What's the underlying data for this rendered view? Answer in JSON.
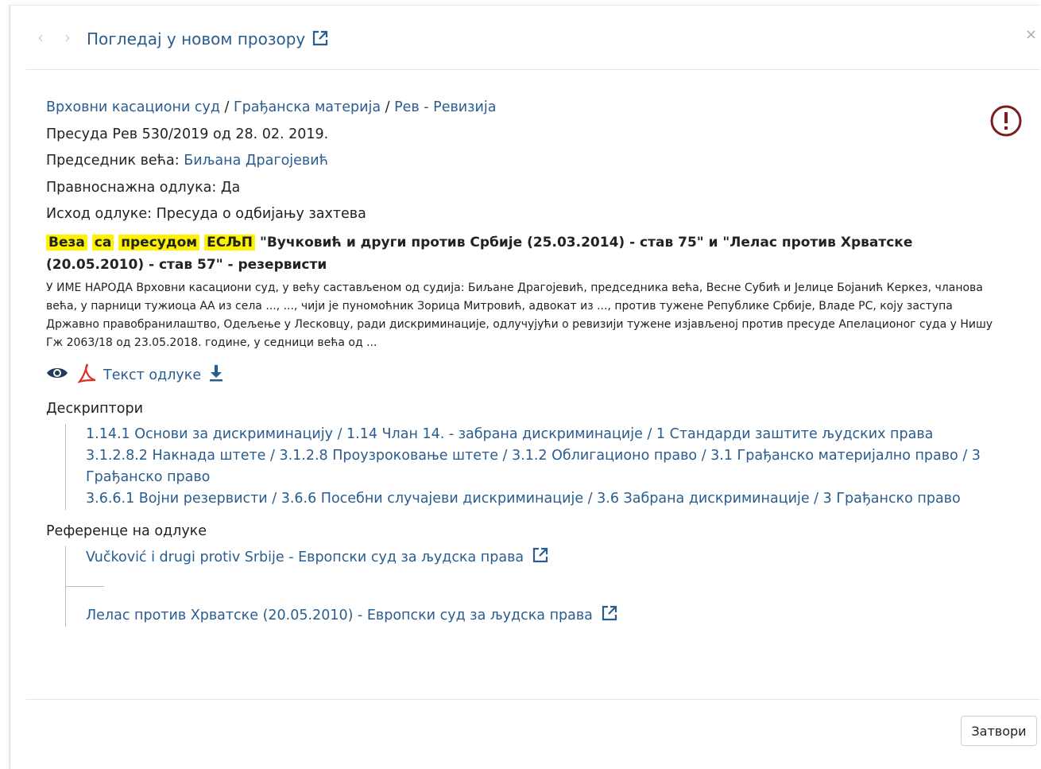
{
  "header": {
    "prev_icon": "chevron-left-icon",
    "next_icon": "chevron-right-icon",
    "open_new_window": "Погледај у новом прозору",
    "close_symbol": "×"
  },
  "breadcrumb": {
    "court": "Врховни касациони суд",
    "matter": "Грађанска материја",
    "type": "Рев - Ревизија",
    "separator": " / "
  },
  "case": {
    "title": "Пресуда Рев 530/2019 од 28. 02. 2019.",
    "president_label": "Председник већа: ",
    "president_name": "Биљана Драгојевић",
    "final_label": "Правноснажна одлука: Да",
    "outcome_label": "Исход одлуке: Пресуда о одбијању захтева"
  },
  "relation": {
    "tags": [
      "Веза",
      "са",
      "пресудом",
      "ЕСЉП"
    ],
    "text": "\"Вучковић и други против Србије (25.03.2014) - став 75\" и \"Лелас против Хрватске (20.05.2010) - став 57\" - резервисти"
  },
  "summary": "У ИМЕ НАРОДА Врховни касациони суд, у већу састављеном од судија: Биљане Драгојевић, председника већа, Весне Субић и Јелице Бојанић Керкез, чланова већа, у парници тужиоца АА из села ..., ..., чији је пуномоћник Зорица Митровић, адвокат из ..., против тужене Републике Србије, Владе РС, коју заступа Државно правобранилаштво, Одељење у Лесковцу, ради дискриминације, одлучујући о ревизији тужене изјављеној против пресуде Апелационог суда у Нишу Гж 2063/18 од 23.05.2018. године, у седници већа од ...",
  "document": {
    "label": "Текст одлуке"
  },
  "descriptors": {
    "title": "Дескриптори",
    "items": [
      "1.14.1 Основи за дискриминацију / 1.14 Члан 14. - забрана дискриминације / 1 Стандарди заштите људских права",
      "3.1.2.8.2 Накнада штете / 3.1.2.8 Проузроковање штете / 3.1.2 Облигационо право / 3.1 Грађанско материјално право / 3",
      "Грађанско право",
      "3.6.6.1 Војни резервисти / 3.6.6 Посебни случајеви дискриминације / 3.6 Забрана дискриминације / 3 Грађанско право"
    ]
  },
  "references": {
    "title": "Референце на одлуке",
    "items": [
      "Vučković i drugi protiv Srbije - Европски суд за људска права",
      "Лелас против Хрватске (20.05.2010) - Европски суд за људска права"
    ]
  },
  "footer": {
    "close_label": "Затвори"
  },
  "colors": {
    "link": "#2a5d8f",
    "highlight": "#fff200",
    "warning": "#7a1f1f",
    "pdf": "#d93025"
  }
}
